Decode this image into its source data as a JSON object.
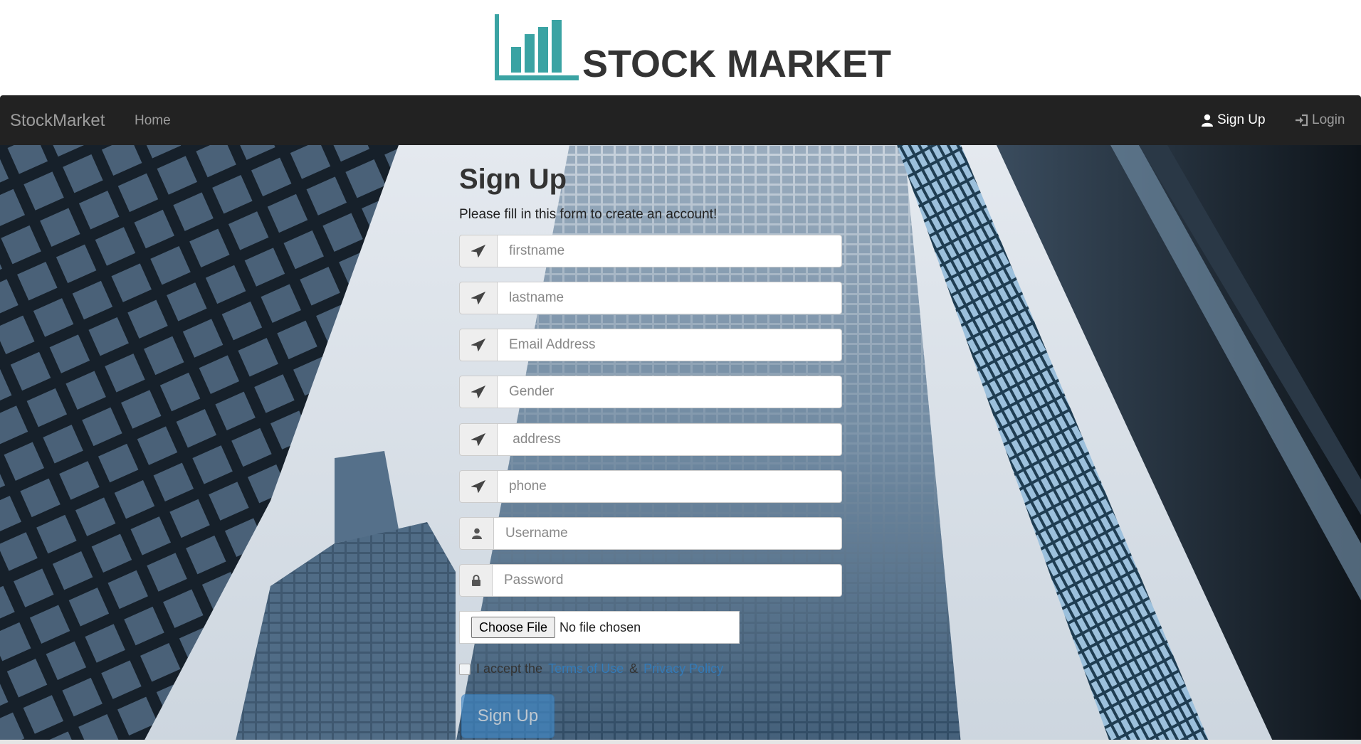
{
  "header": {
    "logo_text": "STOCK MARKET",
    "logo_color": "#3aa3a3"
  },
  "navbar": {
    "brand": "StockMarket",
    "home": "Home",
    "signup": "Sign Up",
    "login": "Login",
    "background": "#222222"
  },
  "form": {
    "title": "Sign Up",
    "subtitle": "Please fill in this form to create an account!",
    "fields": [
      {
        "name": "firstname",
        "placeholder": "firstname",
        "icon": "paper-plane-icon"
      },
      {
        "name": "lastname",
        "placeholder": "lastname",
        "icon": "paper-plane-icon"
      },
      {
        "name": "email",
        "placeholder": "Email Address",
        "icon": "paper-plane-icon"
      },
      {
        "name": "gender",
        "placeholder": "Gender",
        "icon": "paper-plane-icon"
      },
      {
        "name": "address",
        "placeholder": " address",
        "icon": "paper-plane-icon"
      },
      {
        "name": "phone",
        "placeholder": "phone",
        "icon": "paper-plane-icon"
      },
      {
        "name": "username",
        "placeholder": "Username",
        "icon": "user-icon"
      },
      {
        "name": "password",
        "placeholder": "Password",
        "icon": "lock-icon"
      }
    ],
    "file": {
      "button": "Choose File",
      "status": "No file chosen"
    },
    "terms": {
      "prefix": "I accept the",
      "terms_link": "Terms of Use",
      "amp": "&",
      "privacy_link": "Privacy Policy"
    },
    "submit": "Sign Up",
    "accent": "#428bca"
  }
}
